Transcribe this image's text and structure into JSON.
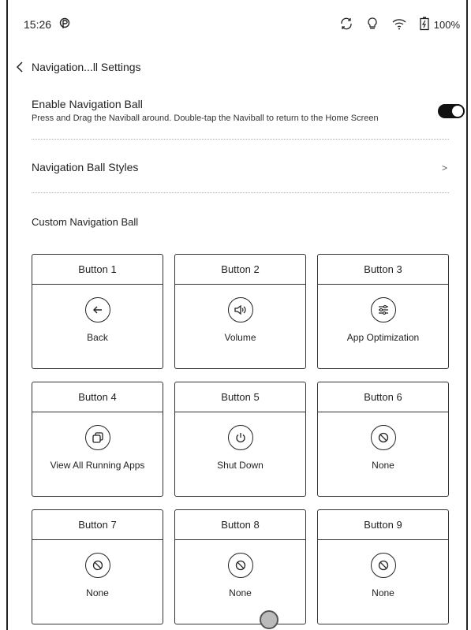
{
  "status": {
    "time": "15:26",
    "battery": "100%",
    "icons": [
      "p-icon",
      "sync-icon",
      "bulb-icon",
      "wifi-icon",
      "battery-icon"
    ]
  },
  "header": {
    "title": "Navigation...ll Settings"
  },
  "enable": {
    "title": "Enable Navigation Ball",
    "description": "Press and Drag the Naviball around. Double-tap the Naviball to return to the Home Screen",
    "enabled": true
  },
  "styles": {
    "label": "Navigation Ball Styles",
    "chevron": ">"
  },
  "custom": {
    "label": "Custom Navigation Ball"
  },
  "buttons": [
    {
      "header": "Button 1",
      "label": "Back",
      "icon": "back-arrow-icon"
    },
    {
      "header": "Button 2",
      "label": "Volume",
      "icon": "volume-icon"
    },
    {
      "header": "Button 3",
      "label": "App Optimization",
      "icon": "sliders-icon"
    },
    {
      "header": "Button 4",
      "label": "View All Running Apps",
      "icon": "running-apps-icon"
    },
    {
      "header": "Button 5",
      "label": "Shut Down",
      "icon": "power-icon"
    },
    {
      "header": "Button 6",
      "label": "None",
      "icon": "none-icon"
    },
    {
      "header": "Button 7",
      "label": "None",
      "icon": "none-icon"
    },
    {
      "header": "Button 8",
      "label": "None",
      "icon": "none-icon"
    },
    {
      "header": "Button 9",
      "label": "None",
      "icon": "none-icon"
    }
  ]
}
